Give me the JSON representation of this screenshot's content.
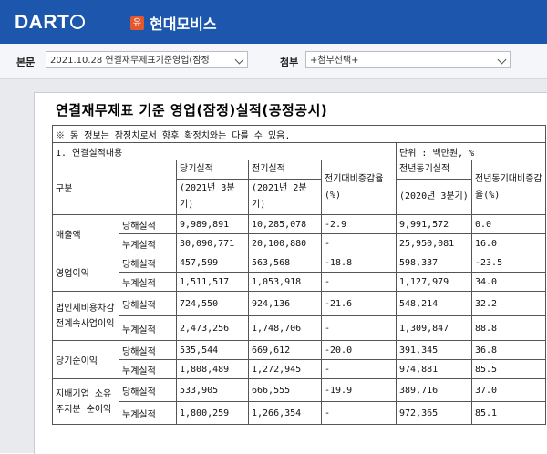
{
  "header": {
    "logo": "DART",
    "company_badge": "유",
    "company_name": "현대모비스"
  },
  "controls": {
    "report_label": "본문",
    "report_value": "2021.10.28  연결재무제표기준영업(잠정",
    "attach_label": "첨부",
    "attach_value": "+첨부선택+"
  },
  "document": {
    "title": "연결재무제표 기준 영업(잠정)실적(공정공시)",
    "notice": "※ 동 정보는 잠정치로서 향후 확정치와는 다를 수 있음.",
    "section": "1. 연결실적내용",
    "unit": "단위 : 백만원, %",
    "col_category": "구분",
    "col_current": "당기실적",
    "col_current_period": "(2021년 3분기)",
    "col_prev": "전기실적",
    "col_prev_period": "(2021년 2분기)",
    "col_qoq": "전기대비증감율(%)",
    "col_yoy_base": "전년동기실적",
    "col_yoy_base_period": "(2020년 3분기)",
    "col_yoy": "전년동기대비증감율(%)",
    "rows": [
      {
        "item": "매출액",
        "q_label": "당해실적",
        "q": [
          "9,989,891",
          "10,285,078",
          "-2.9",
          "9,991,572",
          "0.0"
        ],
        "c_label": "누계실적",
        "c": [
          "30,090,771",
          "20,100,880",
          "-",
          "25,950,081",
          "16.0"
        ]
      },
      {
        "item": "영업이익",
        "q_label": "당해실적",
        "q": [
          "457,599",
          "563,568",
          "-18.8",
          "598,337",
          "-23.5"
        ],
        "c_label": "누계실적",
        "c": [
          "1,511,517",
          "1,053,918",
          "-",
          "1,127,979",
          "34.0"
        ]
      },
      {
        "item": "법인세비용차감전계속사업이익",
        "q_label": "당해실적",
        "q": [
          "724,550",
          "924,136",
          "-21.6",
          "548,214",
          "32.2"
        ],
        "c_label": "누계실적",
        "c": [
          "2,473,256",
          "1,748,706",
          "-",
          "1,309,847",
          "88.8"
        ]
      },
      {
        "item": "당기순이익",
        "q_label": "당해실적",
        "q": [
          "535,544",
          "669,612",
          "-20.0",
          "391,345",
          "36.8"
        ],
        "c_label": "누계실적",
        "c": [
          "1,808,489",
          "1,272,945",
          "-",
          "974,881",
          "85.5"
        ]
      },
      {
        "item": "지배기업 소유주지분 순이익",
        "q_label": "당해실적",
        "q": [
          "533,905",
          "666,555",
          "-19.9",
          "389,716",
          "37.0"
        ],
        "c_label": "누계실적",
        "c": [
          "1,800,259",
          "1,266,354",
          "-",
          "972,365",
          "85.1"
        ]
      }
    ]
  }
}
